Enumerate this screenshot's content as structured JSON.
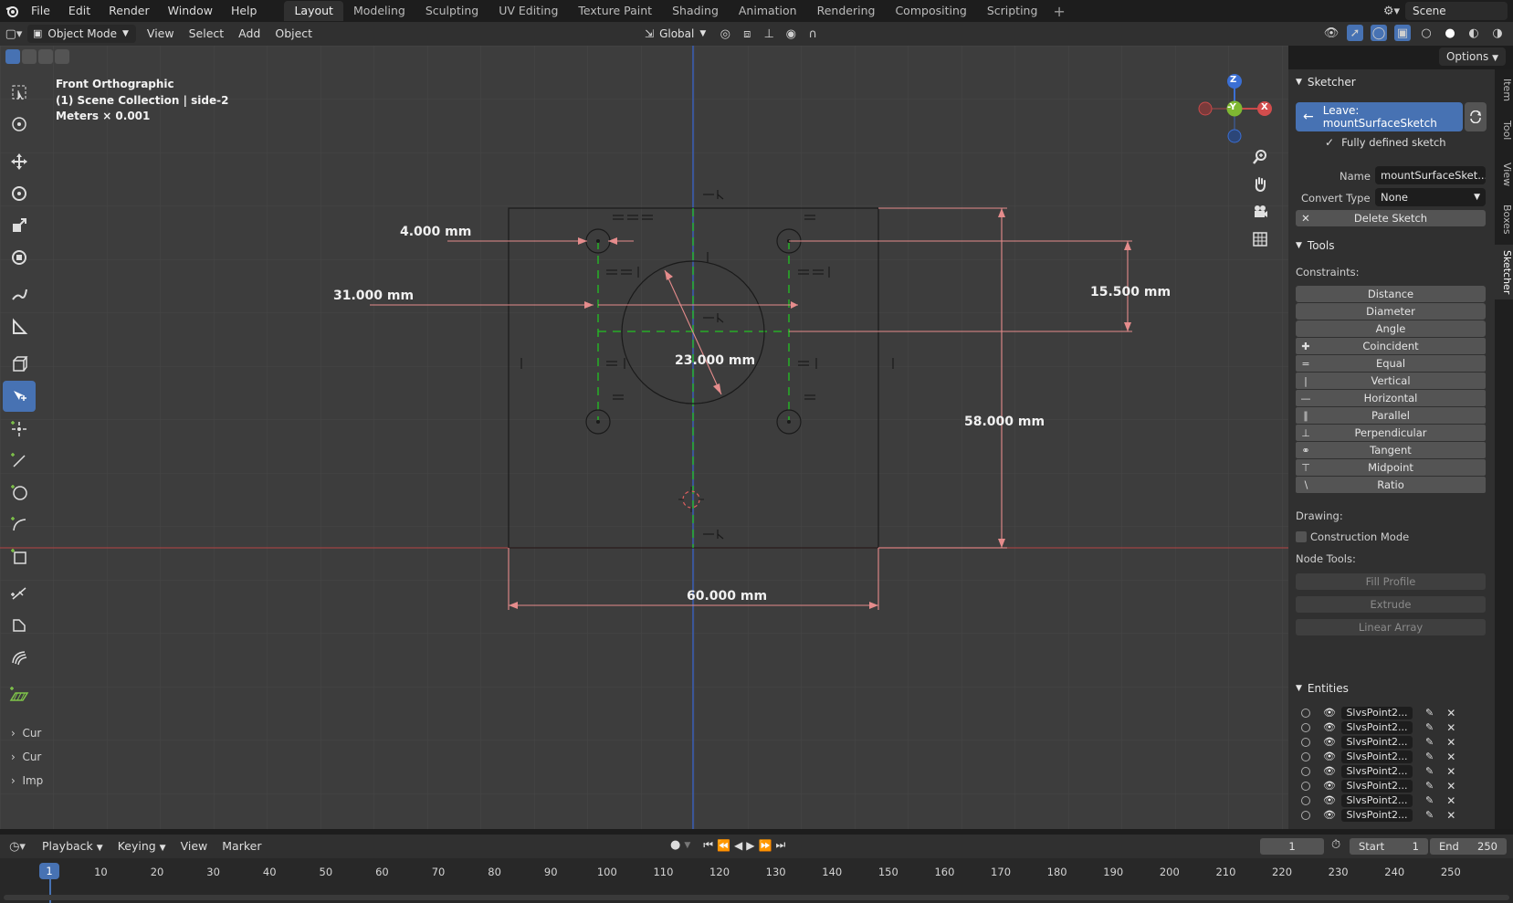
{
  "menu": {
    "items": [
      "File",
      "Edit",
      "Render",
      "Window",
      "Help"
    ],
    "workspaces": [
      "Layout",
      "Modeling",
      "Sculpting",
      "UV Editing",
      "Texture Paint",
      "Shading",
      "Animation",
      "Rendering",
      "Compositing",
      "Scripting"
    ],
    "active_workspace": "Layout",
    "add_tab": "+",
    "scene": "Scene"
  },
  "header": {
    "mode": "Object Mode",
    "menus": [
      "View",
      "Select",
      "Add",
      "Object"
    ],
    "orientation": "Global",
    "options": "Options"
  },
  "viewport": {
    "view_name": "Front Orthographic",
    "collection": "(1) Scene Collection | side-2",
    "units": "Meters × 0.001",
    "dims": {
      "d1": "4.000 mm",
      "d2": "31.000 mm",
      "d3": "23.000 mm",
      "d4": "15.500 mm",
      "d5": "58.000 mm",
      "d6": "60.000 mm"
    },
    "gizmo": {
      "z": "Z",
      "y": "-Y",
      "x": "X"
    },
    "collapsed": [
      "Cur",
      "Cur",
      "Imp"
    ]
  },
  "sidebar": {
    "tabs": [
      "Item",
      "Tool",
      "View",
      "Boxes",
      "Sketcher"
    ],
    "active_tab": "Sketcher",
    "sketcher_title": "Sketcher",
    "leave_label": "Leave: mountSurfaceSketch",
    "status": "Fully defined sketch",
    "name_label": "Name",
    "name_value": "mountSurfaceSket...",
    "convert_label": "Convert Type",
    "convert_value": "None",
    "delete_label": "Delete Sketch",
    "tools_title": "Tools",
    "constraints_label": "Constraints:",
    "plain_constraints": [
      "Distance",
      "Diameter",
      "Angle"
    ],
    "icon_constraints": [
      {
        "label": "Coincident",
        "icon": "coincident-icon"
      },
      {
        "label": "Equal",
        "icon": "equal-icon"
      },
      {
        "label": "Vertical",
        "icon": "vertical-icon"
      },
      {
        "label": "Horizontal",
        "icon": "horizontal-icon"
      },
      {
        "label": "Parallel",
        "icon": "parallel-icon"
      },
      {
        "label": "Perpendicular",
        "icon": "perpendicular-icon"
      },
      {
        "label": "Tangent",
        "icon": "tangent-icon"
      },
      {
        "label": "Midpoint",
        "icon": "midpoint-icon"
      },
      {
        "label": "Ratio",
        "icon": "ratio-icon"
      }
    ],
    "drawing_label": "Drawing:",
    "construction_label": "Construction Mode",
    "node_tools_label": "Node Tools:",
    "node_tools": [
      "Fill Profile",
      "Extrude",
      "Linear Array"
    ],
    "entities_title": "Entities",
    "entities": [
      "SlvsPoint2...",
      "SlvsPoint2...",
      "SlvsPoint2...",
      "SlvsPoint2...",
      "SlvsPoint2...",
      "SlvsPoint2...",
      "SlvsPoint2...",
      "SlvsPoint2..."
    ]
  },
  "timeline": {
    "menus": [
      "Playback",
      "Keying",
      "View",
      "Marker"
    ],
    "current_frame": "1",
    "start_label": "Start",
    "start_value": "1",
    "end_label": "End",
    "end_value": "250",
    "frame_marker": "1",
    "ticks": [
      "10",
      "20",
      "30",
      "40",
      "50",
      "60",
      "70",
      "80",
      "90",
      "100",
      "110",
      "120",
      "130",
      "140",
      "150",
      "160",
      "170",
      "180",
      "190",
      "200",
      "210",
      "220",
      "230",
      "240",
      "250"
    ]
  },
  "colors": {
    "accent": "#4772b3",
    "dimension": "#e58c8c",
    "construction": "#22c222",
    "x_axis": "#c94a4a",
    "z_axis": "#3b6fd4"
  }
}
